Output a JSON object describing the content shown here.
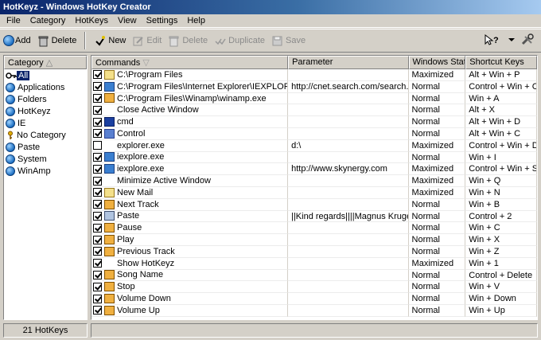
{
  "window": {
    "title": "HotKeyz - Windows HotKey Creator"
  },
  "menu": [
    "File",
    "Category",
    "HotKeys",
    "View",
    "Settings",
    "Help"
  ],
  "toolbar": {
    "add": "Add",
    "delete": "Delete",
    "new": "New",
    "edit": "Edit",
    "delete2": "Delete",
    "duplicate": "Duplicate",
    "save": "Save"
  },
  "category_header": "Category",
  "categories": [
    "All",
    "Applications",
    "Folders",
    "HotKeyz",
    "IE",
    "No Category",
    "Paste",
    "System",
    "WinAmp"
  ],
  "columns": {
    "commands": "Commands",
    "parameter": "Parameter",
    "windows_state": "Windows State",
    "shortcut_keys": "Shortcut Keys"
  },
  "rows": [
    {
      "cmd": "C:\\Program Files",
      "param": "",
      "state": "Maximized",
      "keys": "Alt + Win + P",
      "checked": true
    },
    {
      "cmd": "C:\\Program Files\\Internet Explorer\\IEXPLORE.EXE",
      "param": "http://cnet.search.com/search...",
      "state": "Normal",
      "keys": "Control + Win + C",
      "checked": true
    },
    {
      "cmd": "C:\\Program Files\\Winamp\\winamp.exe",
      "param": "",
      "state": "Normal",
      "keys": "Win + A",
      "checked": true
    },
    {
      "cmd": "Close Active Window",
      "param": "",
      "state": "Normal",
      "keys": "Alt + X",
      "checked": true
    },
    {
      "cmd": "cmd",
      "param": "",
      "state": "Normal",
      "keys": "Alt + Win + D",
      "checked": true
    },
    {
      "cmd": "Control",
      "param": "",
      "state": "Normal",
      "keys": "Alt + Win + C",
      "checked": true
    },
    {
      "cmd": "explorer.exe",
      "param": "d:\\",
      "state": "Maximized",
      "keys": "Control + Win + D",
      "checked": false
    },
    {
      "cmd": "iexplore.exe",
      "param": "",
      "state": "Normal",
      "keys": "Win + I",
      "checked": true
    },
    {
      "cmd": "iexplore.exe",
      "param": "http://www.skynergy.com",
      "state": "Maximized",
      "keys": "Control + Win + S",
      "checked": true
    },
    {
      "cmd": "Minimize Active Window",
      "param": "",
      "state": "Maximized",
      "keys": "Win + Q",
      "checked": true
    },
    {
      "cmd": "New Mail",
      "param": "",
      "state": "Maximized",
      "keys": "Win + N",
      "checked": true
    },
    {
      "cmd": "Next Track",
      "param": "",
      "state": "Normal",
      "keys": "Win + B",
      "checked": true
    },
    {
      "cmd": "Paste",
      "param": "||Kind regards||||Magnus Kruger|...",
      "state": "Normal",
      "keys": "Control + 2",
      "checked": true
    },
    {
      "cmd": "Pause",
      "param": "",
      "state": "Normal",
      "keys": "Win + C",
      "checked": true
    },
    {
      "cmd": "Play",
      "param": "",
      "state": "Normal",
      "keys": "Win + X",
      "checked": true
    },
    {
      "cmd": "Previous Track",
      "param": "",
      "state": "Normal",
      "keys": "Win + Z",
      "checked": true
    },
    {
      "cmd": "Show HotKeyz",
      "param": "",
      "state": "Maximized",
      "keys": "Win + 1",
      "checked": true
    },
    {
      "cmd": "Song Name",
      "param": "",
      "state": "Normal",
      "keys": "Control + Delete",
      "checked": true
    },
    {
      "cmd": "Stop",
      "param": "",
      "state": "Normal",
      "keys": "Win + V",
      "checked": true
    },
    {
      "cmd": "Volume Down",
      "param": "",
      "state": "Normal",
      "keys": "Win + Down",
      "checked": true
    },
    {
      "cmd": "Volume Up",
      "param": "",
      "state": "Normal",
      "keys": "Win + Up",
      "checked": true
    }
  ],
  "status": {
    "count": "21 HotKeys"
  }
}
